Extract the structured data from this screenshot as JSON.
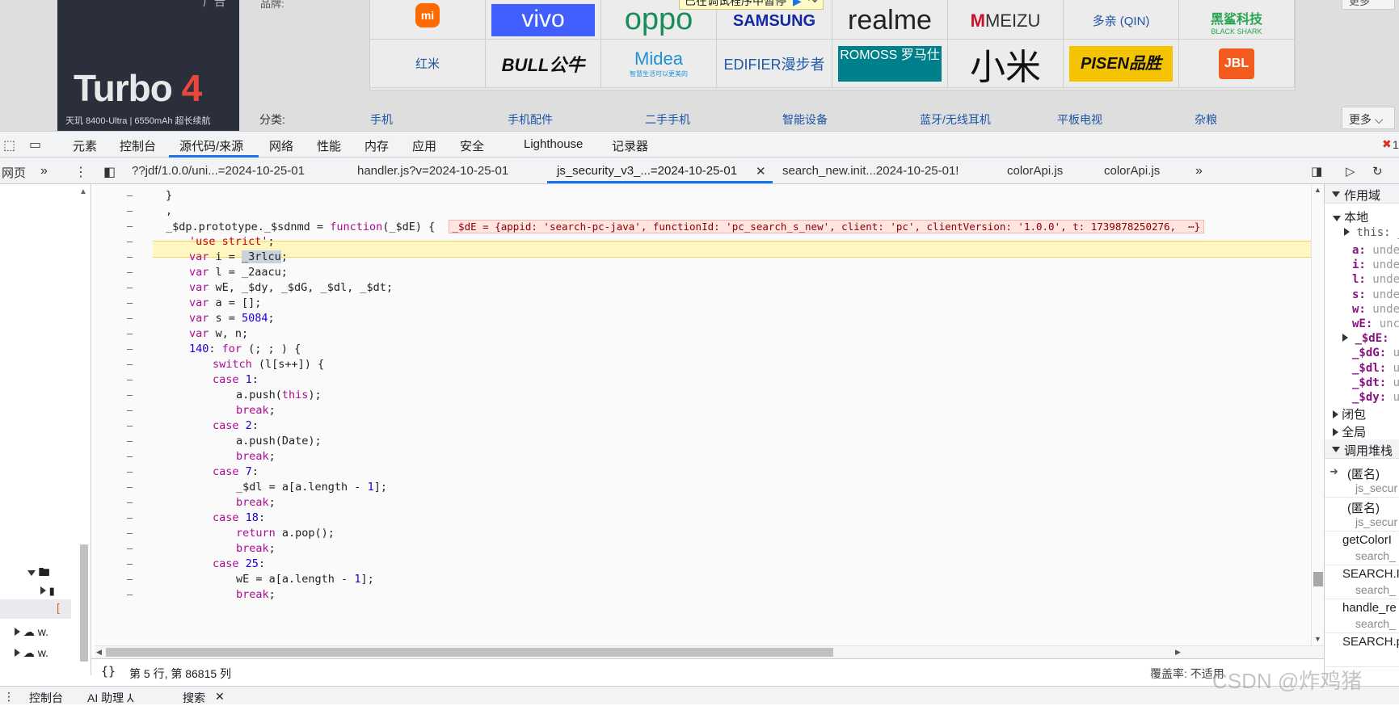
{
  "webpage": {
    "banner": {
      "title_main": "Turbo",
      "title_num": "4",
      "spec": "天玑 8400-Ultra  |  6550mAh 超长续航",
      "top_text": "广告"
    },
    "pinpai_label": "品牌:",
    "more_label": "更多",
    "brands_row1": [
      "mi",
      "vivo",
      "oppo",
      "SAMSUNG",
      "realme",
      "MEIZU",
      "多亲 (QIN)",
      "黑鲨科技"
    ],
    "brands_row2": [
      "红米",
      "BULL公牛",
      "Midea",
      "EDIFIER漫步者",
      "ROMOSS 罗马仕",
      "小米",
      "PISEN品胜",
      "JBL"
    ],
    "midea_sub": "智慧生活可以更美的",
    "blackshark_sub": "BLACK SHARK",
    "category_label": "分类:",
    "categories": [
      "手机",
      "手机配件",
      "二手手机",
      "智能设备",
      "蓝牙/无线耳机",
      "平板电视",
      "杂粮"
    ],
    "debugger_banner": "已在调试程序中暂停"
  },
  "devtools": {
    "main_tabs": [
      "元素",
      "控制台",
      "源代码/来源",
      "网络",
      "性能",
      "内存",
      "应用",
      "安全",
      "Lighthouse",
      "记录器"
    ],
    "active_main_tab": "源代码/来源",
    "error_count": "1",
    "navigator_tab": "网页",
    "file_tabs": [
      "??jdf/1.0.0/uni...=2024-10-25-01",
      "handler.js?v=2024-10-25-01",
      "js_security_v3_...=2024-10-25-01",
      "search_new.init...2024-10-25-01!",
      "colorApi.js",
      "colorApi.js"
    ],
    "active_file_tab": "js_security_v3_...=2024-10-25-01",
    "navigator_items": [
      "w.",
      "w."
    ],
    "code_lines": [
      {
        "gutter": "–",
        "text": "}"
      },
      {
        "gutter": "–",
        "text": ","
      },
      {
        "gutter": "–",
        "text": "_$dp.prototype._$sdnmd = function(_$dE) {"
      },
      {
        "gutter": "–",
        "text": "'use strict';"
      },
      {
        "gutter": "–",
        "text": "var i = _3rlcu;"
      },
      {
        "gutter": "–",
        "text": "var l = _2aacu;"
      },
      {
        "gutter": "–",
        "text": "var wE, _$dy, _$dG, _$dl, _$dt;"
      },
      {
        "gutter": "–",
        "text": "var a = [];"
      },
      {
        "gutter": "–",
        "text": "var s = 5084;"
      },
      {
        "gutter": "–",
        "text": "var w, n;"
      },
      {
        "gutter": "–",
        "text": "140: for (; ; ) {"
      },
      {
        "gutter": "–",
        "text": "switch (l[s++]) {"
      },
      {
        "gutter": "–",
        "text": "case 1:"
      },
      {
        "gutter": "–",
        "text": "a.push(this);"
      },
      {
        "gutter": "–",
        "text": "break;"
      },
      {
        "gutter": "–",
        "text": "case 2:"
      },
      {
        "gutter": "–",
        "text": "a.push(Date);"
      },
      {
        "gutter": "–",
        "text": "break;"
      },
      {
        "gutter": "–",
        "text": "case 7:"
      },
      {
        "gutter": "–",
        "text": "_$dl = a[a.length - 1];"
      },
      {
        "gutter": "–",
        "text": "break;"
      },
      {
        "gutter": "–",
        "text": "case 18:"
      },
      {
        "gutter": "–",
        "text": "return a.pop();"
      },
      {
        "gutter": "–",
        "text": "break;"
      },
      {
        "gutter": "–",
        "text": "case 25:"
      },
      {
        "gutter": "–",
        "text": "wE = a[a.length - 1];"
      },
      {
        "gutter": "–",
        "text": "break;"
      }
    ],
    "inline_value": "_$dE = {appid: 'search-pc-java', functionId: 'pc_search_s_new', client: 'pc', clientVersion: '1.0.0', t: 1739878250276,  ⋯}",
    "status_position": "第 5 行, 第 86815 列",
    "status_coverage": "覆盖率: 不适用",
    "watermark": "CSDN @炸鸡猪",
    "sidebar": {
      "scope_header": "作用域",
      "local_header": "本地",
      "this_label": "this: _",
      "vars": [
        {
          "k": "a:",
          "v": "unde"
        },
        {
          "k": "i:",
          "v": "unde"
        },
        {
          "k": "l:",
          "v": "unde"
        },
        {
          "k": "s:",
          "v": "unde"
        },
        {
          "k": "w:",
          "v": "unde"
        },
        {
          "k": "wE:",
          "v": "unc"
        },
        {
          "k": "_$dE:",
          "v": ""
        },
        {
          "k": "_$dG:",
          "v": "u"
        },
        {
          "k": "_$dl:",
          "v": "u"
        },
        {
          "k": "_$dt:",
          "v": "u"
        },
        {
          "k": "_$dy:",
          "v": "u"
        }
      ],
      "closure": "闭包",
      "global": "全局",
      "callstack_header": "调用堆栈",
      "frames": [
        {
          "fn": "(匿名)",
          "loc": "js_secur"
        },
        {
          "fn": "(匿名)",
          "loc": "js_secur"
        },
        {
          "fn": "getColorI",
          "loc": "search_"
        },
        {
          "fn": "SEARCH.I",
          "loc": "search_"
        },
        {
          "fn": "handle_re",
          "loc": "search_"
        },
        {
          "fn": "SEARCH.p",
          "loc": ""
        }
      ]
    },
    "drawer_tabs": [
      "控制台",
      "AI 助理 ⅄",
      "搜索"
    ]
  },
  "colors": {
    "accent": "#1a73e8",
    "keyword": "#aa0d91",
    "string": "#c80000",
    "number": "#1c00cf",
    "highlight": "#fff7c2"
  }
}
